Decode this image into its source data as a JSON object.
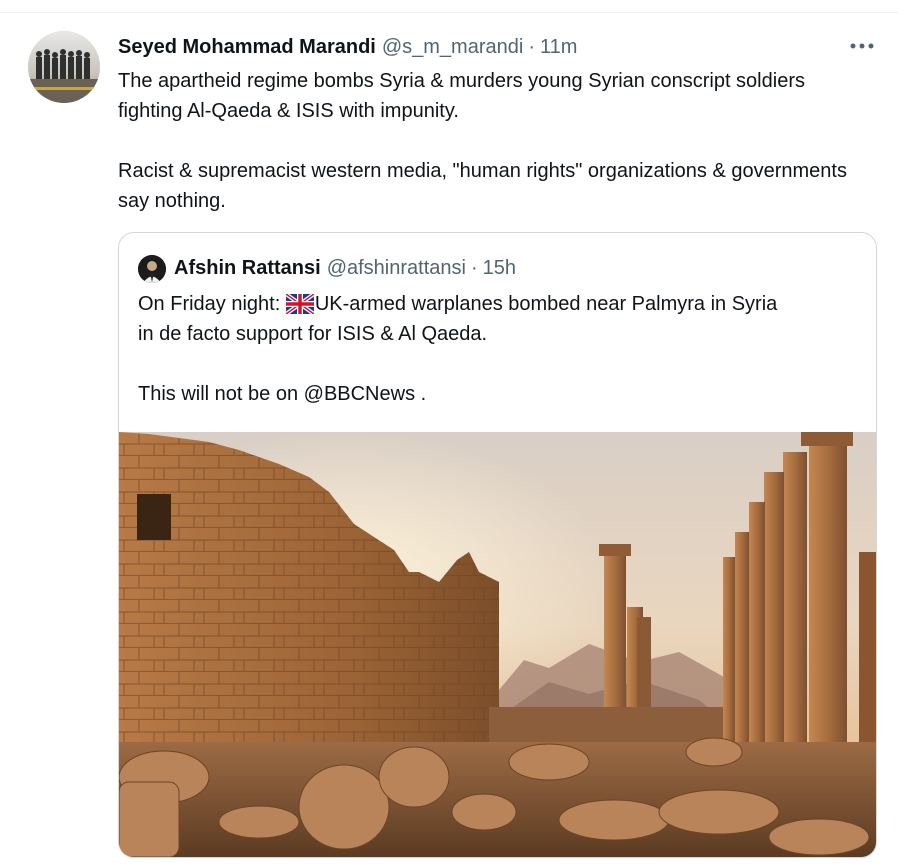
{
  "tweet": {
    "author_name": "Seyed Mohammad Marandi",
    "author_handle": "@s_m_marandi",
    "separator": "·",
    "time": "11m",
    "text_para1": "The apartheid regime bombs Syria & murders young Syrian conscript soldiers fighting Al-Qaeda & ISIS with impunity.",
    "text_para2": "Racist & supremacist western media, \"human rights\" organizations & governments say nothing.",
    "more_icon": "more-horizontal-icon"
  },
  "quoted": {
    "author_name": "Afshin Rattansi",
    "author_handle": "@afshinrattansi",
    "separator": "·",
    "time": "15h",
    "line1_prefix": "On Friday night: ",
    "line1_rest": "UK-armed warplanes bombed near Palmyra in Syria",
    "line2": "in de facto support for ISIS & Al Qaeda.",
    "line3": "This will not be on @BBCNews .",
    "flag_icon": "uk-flag-icon",
    "media_icon": "palmyra-ruins-photo"
  },
  "colors": {
    "text": "#0f1419",
    "secondary": "#536471",
    "border": "#cfd9de"
  }
}
